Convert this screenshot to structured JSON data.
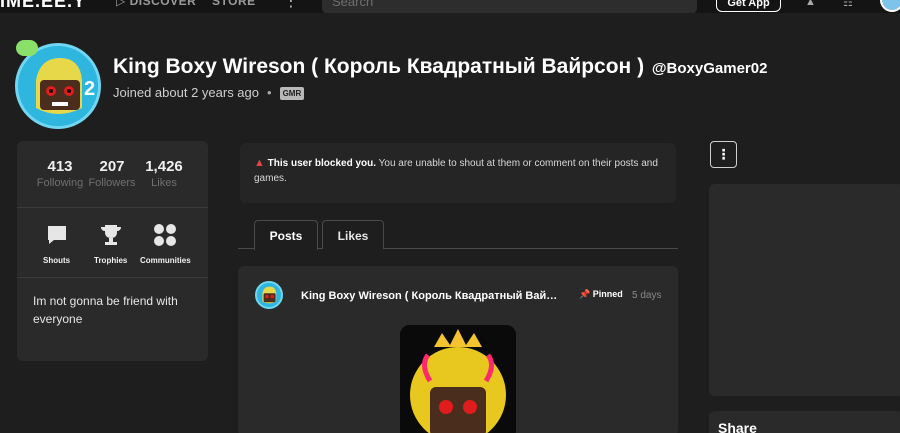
{
  "topbar": {
    "logo": "IME.EE.Y",
    "nav": [
      "▷ DISCOVER",
      "STORE"
    ],
    "more": "⋮",
    "search_placeholder": "Search",
    "get_app": "Get App"
  },
  "profile": {
    "name": "King Boxy Wireson ( Король Квадратный Вайрсон )",
    "username": "@BoxyGamer02",
    "joined": "Joined about 2 years ago",
    "separator": "•",
    "tag": "GMR",
    "level": "2"
  },
  "stats": [
    {
      "value": "413",
      "label": "Following"
    },
    {
      "value": "207",
      "label": "Followers"
    },
    {
      "value": "1,426",
      "label": "Likes"
    }
  ],
  "quick_links": [
    {
      "label": "Shouts",
      "icon": "speech-bubble-icon"
    },
    {
      "label": "Trophies",
      "icon": "trophy-icon"
    },
    {
      "label": "Communities",
      "icon": "communities-icon"
    }
  ],
  "bio": "Im not gonna be friend with everyone",
  "notice": {
    "icon": "▲",
    "bold": "This user blocked you.",
    "text": " You are unable to shout at them or comment on their posts and games."
  },
  "tabs": [
    {
      "label": "Posts",
      "active": true
    },
    {
      "label": "Likes",
      "active": false
    }
  ],
  "post": {
    "author": "King Boxy Wireson ( Король Квадратный Вайрсон )",
    "pinned": "Pinned",
    "time": "5 days"
  },
  "sidebar": {
    "menu": "⋮",
    "share": "Share"
  },
  "colors": {
    "background": "#1e1e1e",
    "card": "#2a2a2a",
    "warning": "#e04646",
    "avatar_bg": "#2fb6de"
  }
}
